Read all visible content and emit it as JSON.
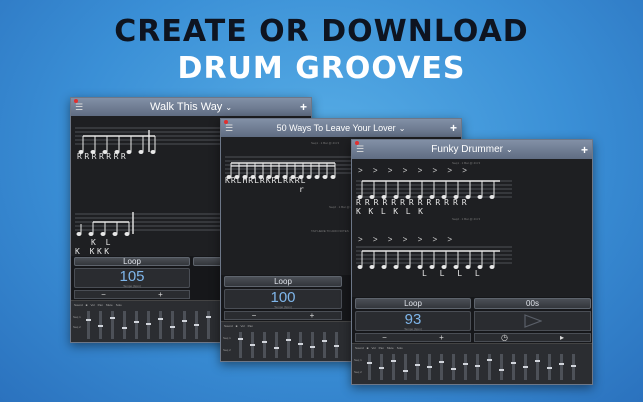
{
  "headline": {
    "line1": "CREATE OR DOWNLOAD",
    "line2": "DRUM GROOVES"
  },
  "windows": {
    "w1": {
      "title": "Walk This Way",
      "stickings1": "RRRRRRR",
      "stickings1_lead": "R",
      "stickings2": "K    L",
      "stickings2_b": "K KKK",
      "loop_label": "Loop",
      "tempo": "105",
      "minus": "−",
      "plus": "+"
    },
    "w2": {
      "title": "50 Ways To Leave Your Lover",
      "stickings1": "KRLHRLRKRLRKRL",
      "stickings1_b": "r",
      "loop_label": "Loop",
      "tempo": "100",
      "minus": "−",
      "plus": "+"
    },
    "w3": {
      "title": "Funky Drummer",
      "accents": "> >  > > > > > >",
      "stickings1": "RRRRRRRRRRRRR",
      "stickings1_b": "K K  L     K  L K",
      "accents2": "> >  > >  > > >",
      "stickings2": "L  L  L  L",
      "loop_label": "Loop",
      "count_label": "00s",
      "tempo": "93",
      "minus": "−",
      "plus": "+"
    }
  },
  "icons": {
    "menu": "hamburger-icon",
    "add": "plus-icon",
    "chevron": "chevron-down-icon",
    "play": "play-icon"
  },
  "colors": {
    "accent_blue": "#7fb6ea",
    "titlebar": "#6f7c92",
    "background": "#3a8fd6"
  }
}
